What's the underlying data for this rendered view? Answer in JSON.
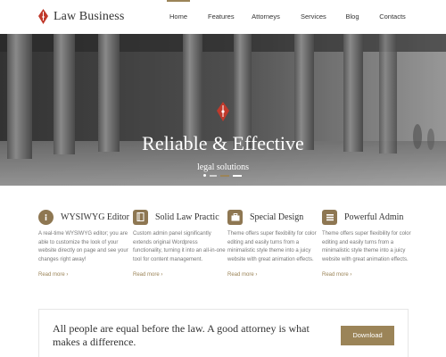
{
  "header": {
    "brand": "Law Business",
    "nav": [
      {
        "label": "Home",
        "active": true
      },
      {
        "label": "Features",
        "active": false
      },
      {
        "label": "Attorneys",
        "active": false
      },
      {
        "label": "Services",
        "active": false
      },
      {
        "label": "Blog",
        "active": false
      },
      {
        "label": "Contacts",
        "active": false
      }
    ]
  },
  "hero": {
    "title": "Reliable & Effective",
    "subtitle": "legal solutions",
    "slides_total": 4,
    "active_slide": 2
  },
  "features": [
    {
      "icon": "info-icon",
      "title": "WYSIWYG Editor",
      "text": "A real-time WYSIWYG editor; you are able to customize the look of your website directly on page and see your changes right away!",
      "link": "Read more"
    },
    {
      "icon": "book-icon",
      "title": "Solid Law Practic",
      "text": "Custom admin panel significantly extends original Wordpress functionality, turning it into an all-in-one tool for content management.",
      "link": "Read more"
    },
    {
      "icon": "briefcase-icon",
      "title": "Special Design",
      "text": "Theme offers super flexibility for color editing and easily turns from a minimalistic style theme into a juicy website with great animation effects.",
      "link": "Read more"
    },
    {
      "icon": "gavel-icon",
      "title": "Powerful Admin",
      "text": "Theme offers super flexibility for color editing and easily turns from a minimalistic style theme into a juicy website with great animation effects.",
      "link": "Read more"
    }
  ],
  "banner": {
    "text": "All people are equal before the law. A good attorney is what makes a difference.",
    "button": "Download"
  },
  "colors": {
    "accent": "#9b8458",
    "logo_red": "#c0392b"
  }
}
